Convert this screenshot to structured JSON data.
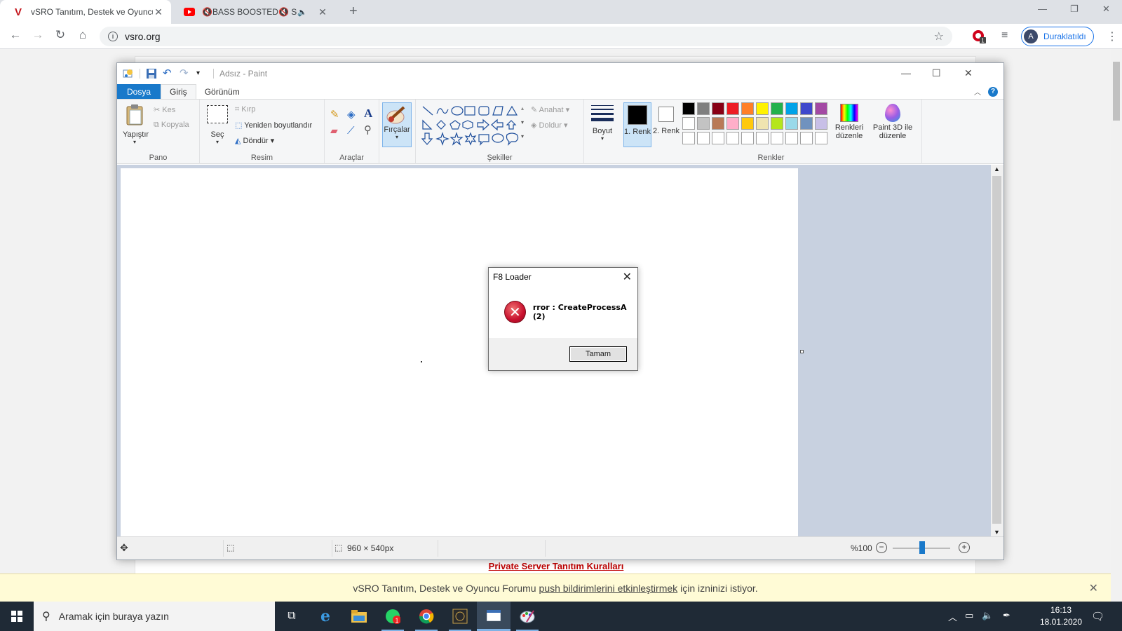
{
  "browser": {
    "tabs": [
      {
        "title": "vSRO Tanıtım, Destek ve Oyuncu",
        "favicon": "v-logo-icon",
        "active": true
      },
      {
        "title": "🔇BASS BOOSTED🔇 SONGS",
        "favicon": "youtube-icon",
        "active": false
      }
    ],
    "url": "vsro.org",
    "profile_initial": "A",
    "profile_label": "Duraklatıldı",
    "extension_badge": "1"
  },
  "page": {
    "link_text": "Private Server Tanıtım Kuralları"
  },
  "notification": {
    "text_before": "vSRO Tanıtım, Destek ve Oyuncu Forumu",
    "link": "push bildirimlerini etkinleştirmek",
    "text_after": "için izninizi istiyor."
  },
  "paint": {
    "title": "Adsız - Paint",
    "tabs": {
      "file": "Dosya",
      "home": "Giriş",
      "view": "Görünüm"
    },
    "clipboard": {
      "paste": "Yapıştır",
      "cut": "Kes",
      "copy": "Kopyala",
      "label": "Pano"
    },
    "image": {
      "select": "Seç",
      "crop": "Kırp",
      "resize": "Yeniden boyutlandır",
      "rotate": "Döndür",
      "label": "Resim"
    },
    "tools": {
      "label": "Araçlar"
    },
    "brushes": {
      "label": "Fırçalar"
    },
    "shapes": {
      "outline": "Anahat",
      "fill": "Doldur",
      "label": "Şekiller"
    },
    "size": {
      "label": "Boyut"
    },
    "colors": {
      "color1": "1. Renk",
      "color2": "2. Renk",
      "edit": "Renkleri düzenle",
      "paint3d": "Paint 3D ile düzenle",
      "label": "Renkler",
      "palette_row1": [
        "#000000",
        "#7f7f7f",
        "#880015",
        "#ed1c24",
        "#ff7f27",
        "#fff200",
        "#22b14c",
        "#00a2e8",
        "#3f48cc",
        "#a349a4"
      ],
      "palette_row2": [
        "#ffffff",
        "#c3c3c3",
        "#b97a57",
        "#ffaec9",
        "#ffc90e",
        "#efe4b0",
        "#b5e61d",
        "#99d9ea",
        "#7092be",
        "#c8bfe7"
      ]
    },
    "status": {
      "dimensions": "960 × 540px",
      "zoom": "%100"
    }
  },
  "dialog": {
    "title": "F8 Loader",
    "message": "rror : CreateProcessA (2)",
    "ok": "Tamam"
  },
  "taskbar": {
    "search_placeholder": "Aramak için buraya yazın",
    "whatsapp_badge": "1",
    "time": "16:13",
    "date": "18.01.2020"
  }
}
